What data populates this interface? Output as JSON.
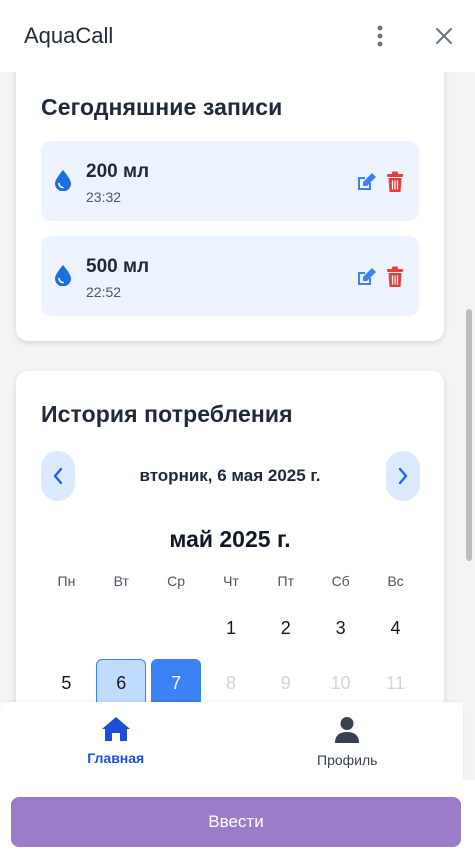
{
  "app": {
    "title": "AquaCall"
  },
  "today": {
    "title": "Сегодняшние записи",
    "entries": [
      {
        "amount": "200 мл",
        "time": "23:32"
      },
      {
        "amount": "500 мл",
        "time": "22:52"
      }
    ]
  },
  "history": {
    "title": "История потребления",
    "selected_date": "вторник, 6 мая 2025 г.",
    "month": "май 2025 г.",
    "weekdays": [
      "Пн",
      "Вт",
      "Ср",
      "Чт",
      "Пт",
      "Сб",
      "Вс"
    ],
    "week1": [
      "",
      "",
      "",
      "1",
      "2",
      "3",
      "4"
    ],
    "week2": [
      "5",
      "6",
      "7",
      "8",
      "9",
      "10",
      "11"
    ]
  },
  "nav": {
    "home": "Главная",
    "profile": "Профиль"
  },
  "submit_label": "Ввести",
  "colors": {
    "primary": "#3b82f6",
    "danger": "#e53e3e",
    "submit": "#9b7cc8",
    "entry_bg": "#eef4ff"
  }
}
